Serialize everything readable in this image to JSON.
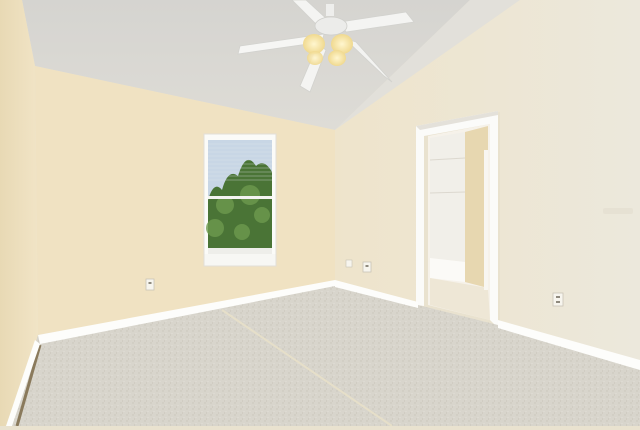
{
  "scene": {
    "description_visible_text": "",
    "colors": {
      "ceiling": "#d8d8d4",
      "left_wall": "#efe3c6",
      "back_wall": "#f0e2c2",
      "right_wall": "#ece5d2",
      "carpet": "#d9d6cd",
      "baseboard": "#ffffff",
      "window_sky": "#c9d7e6",
      "window_trees": "#4f7a3a",
      "fan_white": "#f4f4f2",
      "light_glow": "#fff4c2"
    },
    "icons": [
      "ceiling-fan-icon",
      "outlet-icon"
    ]
  }
}
